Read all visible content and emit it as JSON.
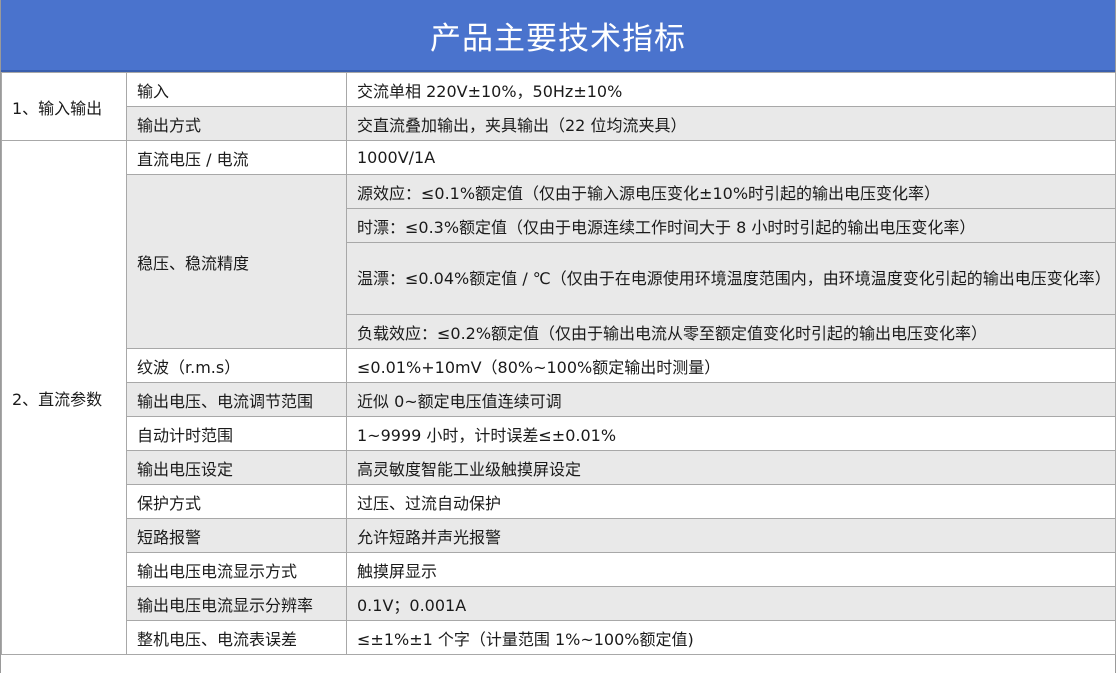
{
  "title": "产品主要技术指标",
  "groups": {
    "g1": "1、输入输出",
    "g2": "2、直流参数"
  },
  "rows": {
    "r1": {
      "param": "输入",
      "value": "交流单相 220V±10%，50Hz±10%"
    },
    "r2": {
      "param": "输出方式",
      "value": "交直流叠加输出，夹具输出（22 位均流夹具）"
    },
    "r3": {
      "param": "直流电压 / 电流",
      "value": "1000V/1A"
    },
    "r4": {
      "param": "稳压、稳流精度",
      "values": [
        "源效应：≤0.1%额定值（仅由于输入源电压变化±10%时引起的输出电压变化率）",
        "时漂：≤0.3%额定值（仅由于电源连续工作时间大于 8 小时时引起的输出电压变化率）",
        "温漂：≤0.04%额定值 / ℃（仅由于在电源使用环境温度范围内，由环境温度变化引起的输出电压变化率）",
        "负载效应：≤0.2%额定值（仅由于输出电流从零至额定值变化时引起的输出电压变化率）"
      ]
    },
    "r5": {
      "param": "纹波（r.m.s）",
      "value": "≤0.01%+10mV（80%~100%额定输出时测量）"
    },
    "r6": {
      "param": "输出电压、电流调节范围",
      "value": "近似 0~额定电压值连续可调"
    },
    "r7": {
      "param": "自动计时范围",
      "value": "1~9999 小时，计时误差≤±0.01%"
    },
    "r8": {
      "param": "输出电压设定",
      "value": "高灵敏度智能工业级触摸屏设定"
    },
    "r9": {
      "param": "保护方式",
      "value": "过压、过流自动保护"
    },
    "r10": {
      "param": "短路报警",
      "value": "允许短路并声光报警"
    },
    "r11": {
      "param": "输出电压电流显示方式",
      "value": "触摸屏显示"
    },
    "r12": {
      "param": "输出电压电流显示分辨率",
      "value": "0.1V；0.001A"
    },
    "r13": {
      "param": "整机电压、电流表误差",
      "value": "≤±1%±1 个字（计量范围 1%~100%额定值)"
    }
  }
}
